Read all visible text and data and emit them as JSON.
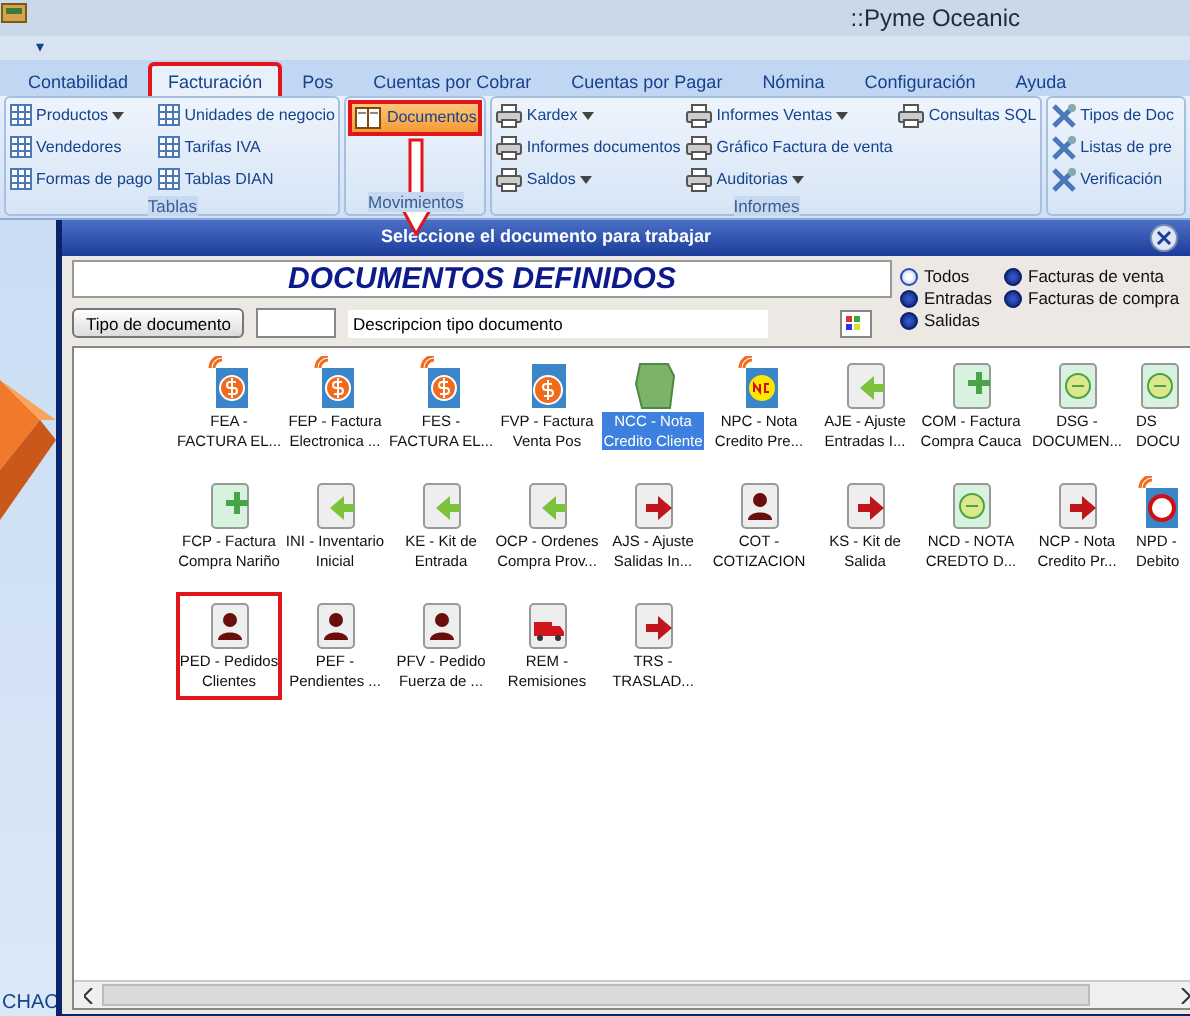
{
  "window": {
    "title": "::Pyme Oceanic",
    "quick_access": "▾"
  },
  "tabs": [
    {
      "label": "Contabilidad",
      "selected": false,
      "highlighted": false
    },
    {
      "label": "Facturación",
      "selected": true,
      "highlighted": true
    },
    {
      "label": "Pos",
      "selected": false,
      "highlighted": false
    },
    {
      "label": "Cuentas por Cobrar",
      "selected": false,
      "highlighted": false
    },
    {
      "label": "Cuentas por Pagar",
      "selected": false,
      "highlighted": false
    },
    {
      "label": "Nómina",
      "selected": false,
      "highlighted": false
    },
    {
      "label": "Configuración",
      "selected": false,
      "highlighted": false
    },
    {
      "label": "Ayuda",
      "selected": false,
      "highlighted": false
    }
  ],
  "ribbon_groups": [
    {
      "label": "Tablas",
      "columns": [
        [
          {
            "label": "Productos",
            "kind": "table",
            "dropdown": true
          },
          {
            "label": "Vendedores",
            "kind": "table",
            "dropdown": false
          },
          {
            "label": "Formas de pago",
            "kind": "table",
            "dropdown": false
          }
        ],
        [
          {
            "label": "Unidades de negocio",
            "kind": "table",
            "dropdown": false
          },
          {
            "label": "Tarifas IVA",
            "kind": "table",
            "dropdown": false
          },
          {
            "label": "Tablas DIAN",
            "kind": "table",
            "dropdown": false
          }
        ]
      ]
    },
    {
      "label": "Movimientos",
      "columns": [
        [
          {
            "label": "Documentos",
            "kind": "book",
            "dropdown": false,
            "highlighted": true
          }
        ]
      ]
    },
    {
      "label": "Informes",
      "columns": [
        [
          {
            "label": "Kardex",
            "kind": "printer",
            "dropdown": true
          },
          {
            "label": "Informes documentos",
            "kind": "printer",
            "dropdown": false
          },
          {
            "label": "Saldos",
            "kind": "printer",
            "dropdown": true
          }
        ],
        [
          {
            "label": "Informes Ventas",
            "kind": "printer",
            "dropdown": true
          },
          {
            "label": "Gráfico Factura de venta",
            "kind": "printer",
            "dropdown": false
          },
          {
            "label": "Auditorias",
            "kind": "printer",
            "dropdown": true
          }
        ],
        [
          {
            "label": "Consultas SQL",
            "kind": "printer",
            "dropdown": false
          }
        ]
      ]
    },
    {
      "columns": [
        [
          {
            "label": "Tipos de Doc",
            "kind": "tools",
            "dropdown": false
          },
          {
            "label": "Listas de pre",
            "kind": "tools",
            "dropdown": false
          },
          {
            "label": "Verificación",
            "kind": "tools",
            "dropdown": false
          }
        ]
      ]
    }
  ],
  "background": {
    "text": "CHAC"
  },
  "dialog": {
    "title": "Seleccione el documento para trabajar",
    "heading": "DOCUMENTOS DEFINIDOS",
    "filters": [
      {
        "label": "Todos",
        "selected": true
      },
      {
        "label": "Entradas",
        "selected": false
      },
      {
        "label": "Salidas",
        "selected": false
      },
      {
        "label": "Facturas de venta",
        "selected": false
      },
      {
        "label": "Facturas de compra",
        "selected": false
      }
    ],
    "type_button": "Tipo de documento",
    "description": {
      "value": "Descripcion tipo documento"
    },
    "documents": [
      {
        "lines": [
          "FEA -",
          "FACTURA EL..."
        ],
        "kind": "invoice",
        "selected": false,
        "highlighted": false
      },
      {
        "lines": [
          "FEP - Factura",
          "Electronica ..."
        ],
        "kind": "invoice",
        "selected": false,
        "highlighted": false
      },
      {
        "lines": [
          "FES -",
          "FACTURA EL..."
        ],
        "kind": "invoice",
        "selected": false,
        "highlighted": false
      },
      {
        "lines": [
          "FVP - Factura",
          "Venta Pos"
        ],
        "kind": "pos",
        "selected": false,
        "highlighted": false
      },
      {
        "lines": [
          "NCC - Nota",
          "Credito Cliente"
        ],
        "kind": "note",
        "selected": true,
        "highlighted": false
      },
      {
        "lines": [
          "NPC - Nota",
          "Credito Pre..."
        ],
        "kind": "nc",
        "selected": false,
        "highlighted": false
      },
      {
        "lines": [
          "AJE - Ajuste",
          "Entradas I..."
        ],
        "kind": "entry",
        "selected": false,
        "highlighted": false
      },
      {
        "lines": [
          "COM - Factura",
          "Compra Cauca"
        ],
        "kind": "plus",
        "selected": false,
        "highlighted": false
      },
      {
        "lines": [
          "DSG -",
          "DOCUMEN..."
        ],
        "kind": "ds",
        "selected": false,
        "highlighted": false
      },
      {
        "lines": [
          "DS",
          "DOCU"
        ],
        "kind": "ds",
        "selected": false,
        "highlighted": false
      },
      {
        "lines": [
          "FCP - Factura",
          "Compra Nariño"
        ],
        "kind": "plus",
        "selected": false,
        "highlighted": false
      },
      {
        "lines": [
          "INI - Inventario",
          "Inicial"
        ],
        "kind": "entry",
        "selected": false,
        "highlighted": false
      },
      {
        "lines": [
          "KE - Kit de",
          "Entrada"
        ],
        "kind": "entry",
        "selected": false,
        "highlighted": false
      },
      {
        "lines": [
          "OCP - Ordenes",
          "Compra Prov..."
        ],
        "kind": "entry",
        "selected": false,
        "highlighted": false
      },
      {
        "lines": [
          "AJS - Ajuste",
          "Salidas In..."
        ],
        "kind": "exit",
        "selected": false,
        "highlighted": false
      },
      {
        "lines": [
          "COT -",
          "COTIZACION"
        ],
        "kind": "person",
        "selected": false,
        "highlighted": false
      },
      {
        "lines": [
          "KS - Kit de",
          "Salida"
        ],
        "kind": "exit",
        "selected": false,
        "highlighted": false
      },
      {
        "lines": [
          "NCD - NOTA",
          "CREDTO D..."
        ],
        "kind": "ds",
        "selected": false,
        "highlighted": false
      },
      {
        "lines": [
          "NCP - Nota",
          "Credito Pr..."
        ],
        "kind": "exit",
        "selected": false,
        "highlighted": false
      },
      {
        "lines": [
          "NPD -",
          "Debito"
        ],
        "kind": "debit",
        "selected": false,
        "highlighted": false
      },
      {
        "lines": [
          "PED - Pedidos",
          "Clientes"
        ],
        "kind": "person",
        "selected": false,
        "highlighted": true
      },
      {
        "lines": [
          "PEF -",
          "Pendientes ..."
        ],
        "kind": "person",
        "selected": false,
        "highlighted": false
      },
      {
        "lines": [
          "PFV - Pedido",
          "Fuerza de ..."
        ],
        "kind": "person",
        "selected": false,
        "highlighted": false
      },
      {
        "lines": [
          "REM -",
          "Remisiones"
        ],
        "kind": "truck",
        "selected": false,
        "highlighted": false
      },
      {
        "lines": [
          "TRS -",
          "TRASLAD..."
        ],
        "kind": "exit",
        "selected": false,
        "highlighted": false
      }
    ]
  }
}
